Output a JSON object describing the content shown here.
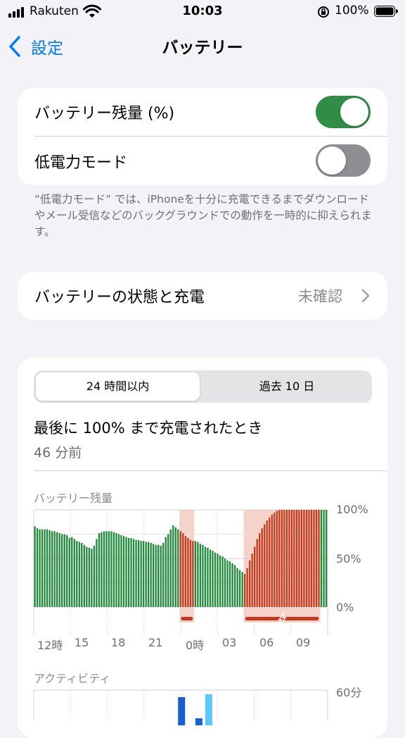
{
  "status_bar": {
    "carrier": "Rakuten",
    "time": "10:03",
    "battery_percent": "100%"
  },
  "nav": {
    "back_label": "設定",
    "title": "バッテリー"
  },
  "settings": {
    "battery_percentage": {
      "label": "バッテリー残量 (%)",
      "on": true
    },
    "low_power_mode": {
      "label": "低電力モード",
      "on": false
    },
    "footnote": "“低電力モード” では、iPhoneを十分に充電できるまでダウンロードやメール受信などのバックグラウンドでの動作を一時的に抑えられます。",
    "battery_health": {
      "label": "バッテリーの状態と充電",
      "value": "未確認"
    }
  },
  "usage": {
    "tabs": [
      "24 時間以内",
      "過去 10 日"
    ],
    "selected_tab": 0,
    "last_charge_title": "最後に 100% まで充電されたとき",
    "last_charge_time": "46 分前",
    "battery_level_label": "バッテリー残量",
    "activity_label": "アクティビティ"
  },
  "colors": {
    "toggle_on": "#2f8d45",
    "toggle_off": "#8e8e93",
    "battery_bar": "#1f8a3a",
    "charging_bar": "#c8391b",
    "charging_shade": "#f6d3ca",
    "activity_screen_on": "#1a5fd0",
    "activity_screen_off": "#5ac8fa",
    "link_blue": "#007aff"
  },
  "chart_data": [
    {
      "type": "bar",
      "title": "バッテリー残量",
      "y_ticks": [
        "100%",
        "50%",
        "0%"
      ],
      "ylim": [
        0,
        100
      ],
      "x_tick_labels": [
        "12時",
        "15",
        "18",
        "21",
        "0時",
        "03",
        "06",
        "09"
      ],
      "series": [
        {
          "values": [
            83,
            81,
            80,
            80,
            80,
            80,
            79,
            78,
            78,
            77,
            76,
            75,
            75,
            74,
            71,
            72,
            70,
            68,
            67,
            66,
            64,
            62,
            61,
            60,
            63,
            70,
            76,
            77,
            78,
            78,
            78,
            78,
            77,
            76,
            75,
            74,
            73,
            72,
            71,
            71,
            70,
            69,
            69,
            68,
            68,
            67,
            67,
            66,
            65,
            64,
            64,
            63,
            66,
            72,
            75,
            80,
            84,
            82,
            80,
            78,
            76,
            73,
            71,
            69,
            68,
            68,
            67,
            65,
            64,
            62,
            61,
            59,
            58,
            56,
            55,
            53,
            52,
            50,
            48,
            47,
            45,
            43,
            40,
            38,
            36,
            34,
            40,
            48,
            55,
            62,
            70,
            76,
            81,
            85,
            89,
            92,
            95,
            97,
            99,
            100,
            100,
            100,
            100,
            100,
            100,
            100,
            100,
            100,
            100,
            100,
            100,
            100,
            100,
            100,
            100,
            100,
            100,
            100,
            100
          ],
          "charging_from_index": [
            59,
            85
          ],
          "charging_to_index": [
            64,
            115
          ]
        }
      ]
    },
    {
      "type": "bar",
      "title": "アクティビティ",
      "y_ticks": [
        "60分"
      ],
      "ylim": [
        0,
        60
      ],
      "series": [
        {
          "values": [
            0,
            0,
            0,
            0,
            0,
            0,
            0,
            0,
            0,
            0,
            0,
            0,
            0,
            0,
            0,
            0,
            0,
            0,
            0,
            0,
            0,
            0,
            0,
            0,
            0,
            0,
            0,
            0,
            0,
            0,
            0,
            0,
            0,
            0,
            0,
            0,
            0,
            0,
            0,
            0,
            0,
            0,
            0,
            0,
            0,
            0,
            0,
            0,
            0,
            0,
            0,
            0,
            0,
            0,
            0,
            0,
            0,
            0,
            0,
            40,
            0,
            0,
            0,
            0,
            0,
            0,
            10,
            0,
            0,
            0,
            44,
            0,
            0,
            0,
            0,
            0,
            0,
            0,
            0,
            0,
            0,
            0,
            0,
            0,
            0,
            0,
            0,
            0,
            0,
            0,
            0,
            0,
            0,
            0,
            0,
            0,
            0,
            0,
            0,
            0,
            0,
            0,
            0,
            0,
            0,
            0,
            0,
            0,
            0,
            0,
            0,
            0,
            0,
            0,
            0,
            0,
            0,
            0,
            0
          ]
        }
      ]
    }
  ]
}
